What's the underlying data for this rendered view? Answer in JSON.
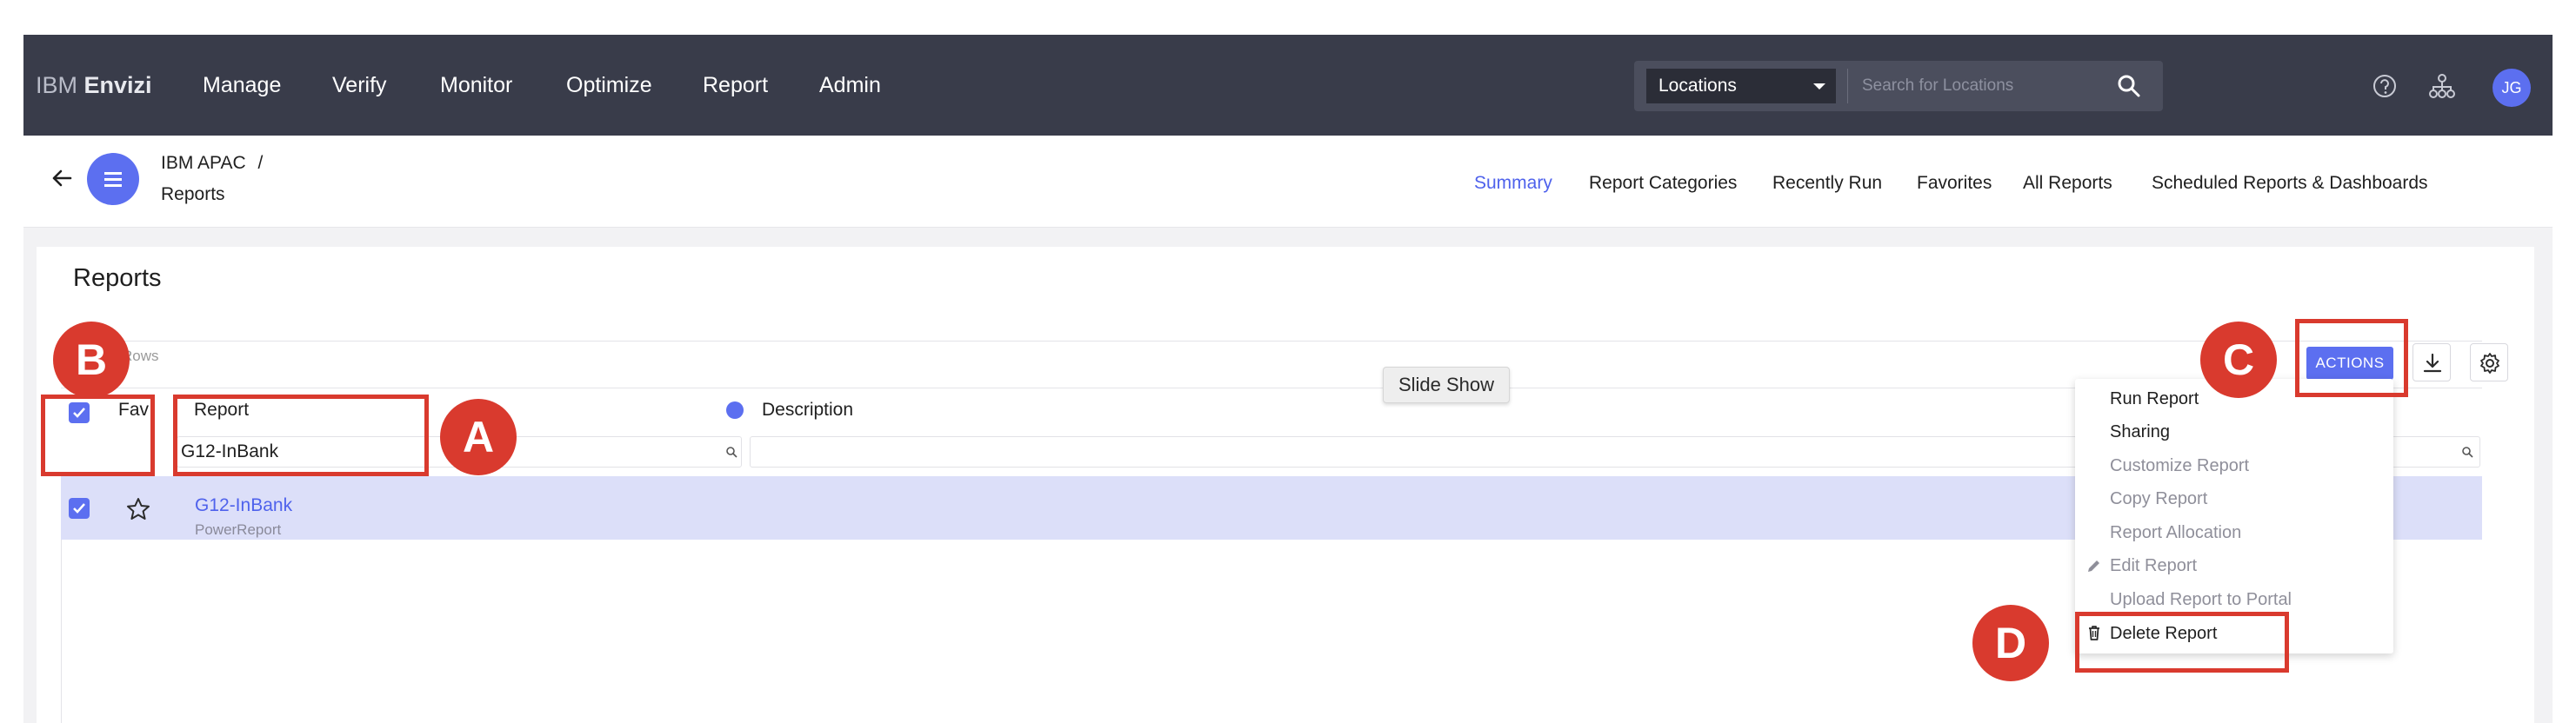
{
  "header": {
    "brand_light": "IBM",
    "brand_bold": "Envizi",
    "nav": [
      "Manage",
      "Verify",
      "Monitor",
      "Optimize",
      "Report",
      "Admin"
    ],
    "location_select": "Locations",
    "search_placeholder": "Search for Locations",
    "avatar_initials": "JG",
    "icons": [
      "help-icon",
      "hierarchy-icon",
      "search-icon"
    ]
  },
  "breadcrumb": {
    "parent": "IBM APAC",
    "separator": "/",
    "current": "Reports"
  },
  "subtabs": [
    "Summary",
    "Report Categories",
    "Recently Run",
    "Favorites",
    "All Reports",
    "Scheduled Reports & Dashboards"
  ],
  "active_subtab": "Summary",
  "panel": {
    "title": "Reports",
    "rows_label": "Rows",
    "columns": {
      "fav": "Fav",
      "report": "Report",
      "description": "Description"
    },
    "report_filter_value": "G12-InBank",
    "description_filter_value": ""
  },
  "rows": [
    {
      "name": "G12-InBank",
      "type": "PowerReport",
      "selected": true,
      "favorite": false
    }
  ],
  "tooltip": "Slide Show",
  "toolbar": {
    "actions_label": "ACTIONS",
    "icons": [
      "download-icon",
      "settings-icon"
    ]
  },
  "actions_menu": [
    {
      "label": "Run Report",
      "enabled": true
    },
    {
      "label": "Sharing",
      "enabled": true
    },
    {
      "label": "Customize Report",
      "enabled": false
    },
    {
      "label": "Copy Report",
      "enabled": false
    },
    {
      "label": "Report Allocation",
      "enabled": false
    },
    {
      "label": "Edit Report",
      "enabled": false,
      "icon": "pencil-icon"
    },
    {
      "label": "Upload Report to Portal",
      "enabled": false
    },
    {
      "label": "Delete Report",
      "enabled": true,
      "icon": "trash-icon"
    }
  ],
  "annotations": [
    "A",
    "B",
    "C",
    "D"
  ],
  "colors": {
    "nav_bg": "#393c4a",
    "accent": "#5c6ff0",
    "link": "#4f62ec",
    "selected_row": "#dcdff9",
    "annotation": "#d93a2e"
  }
}
